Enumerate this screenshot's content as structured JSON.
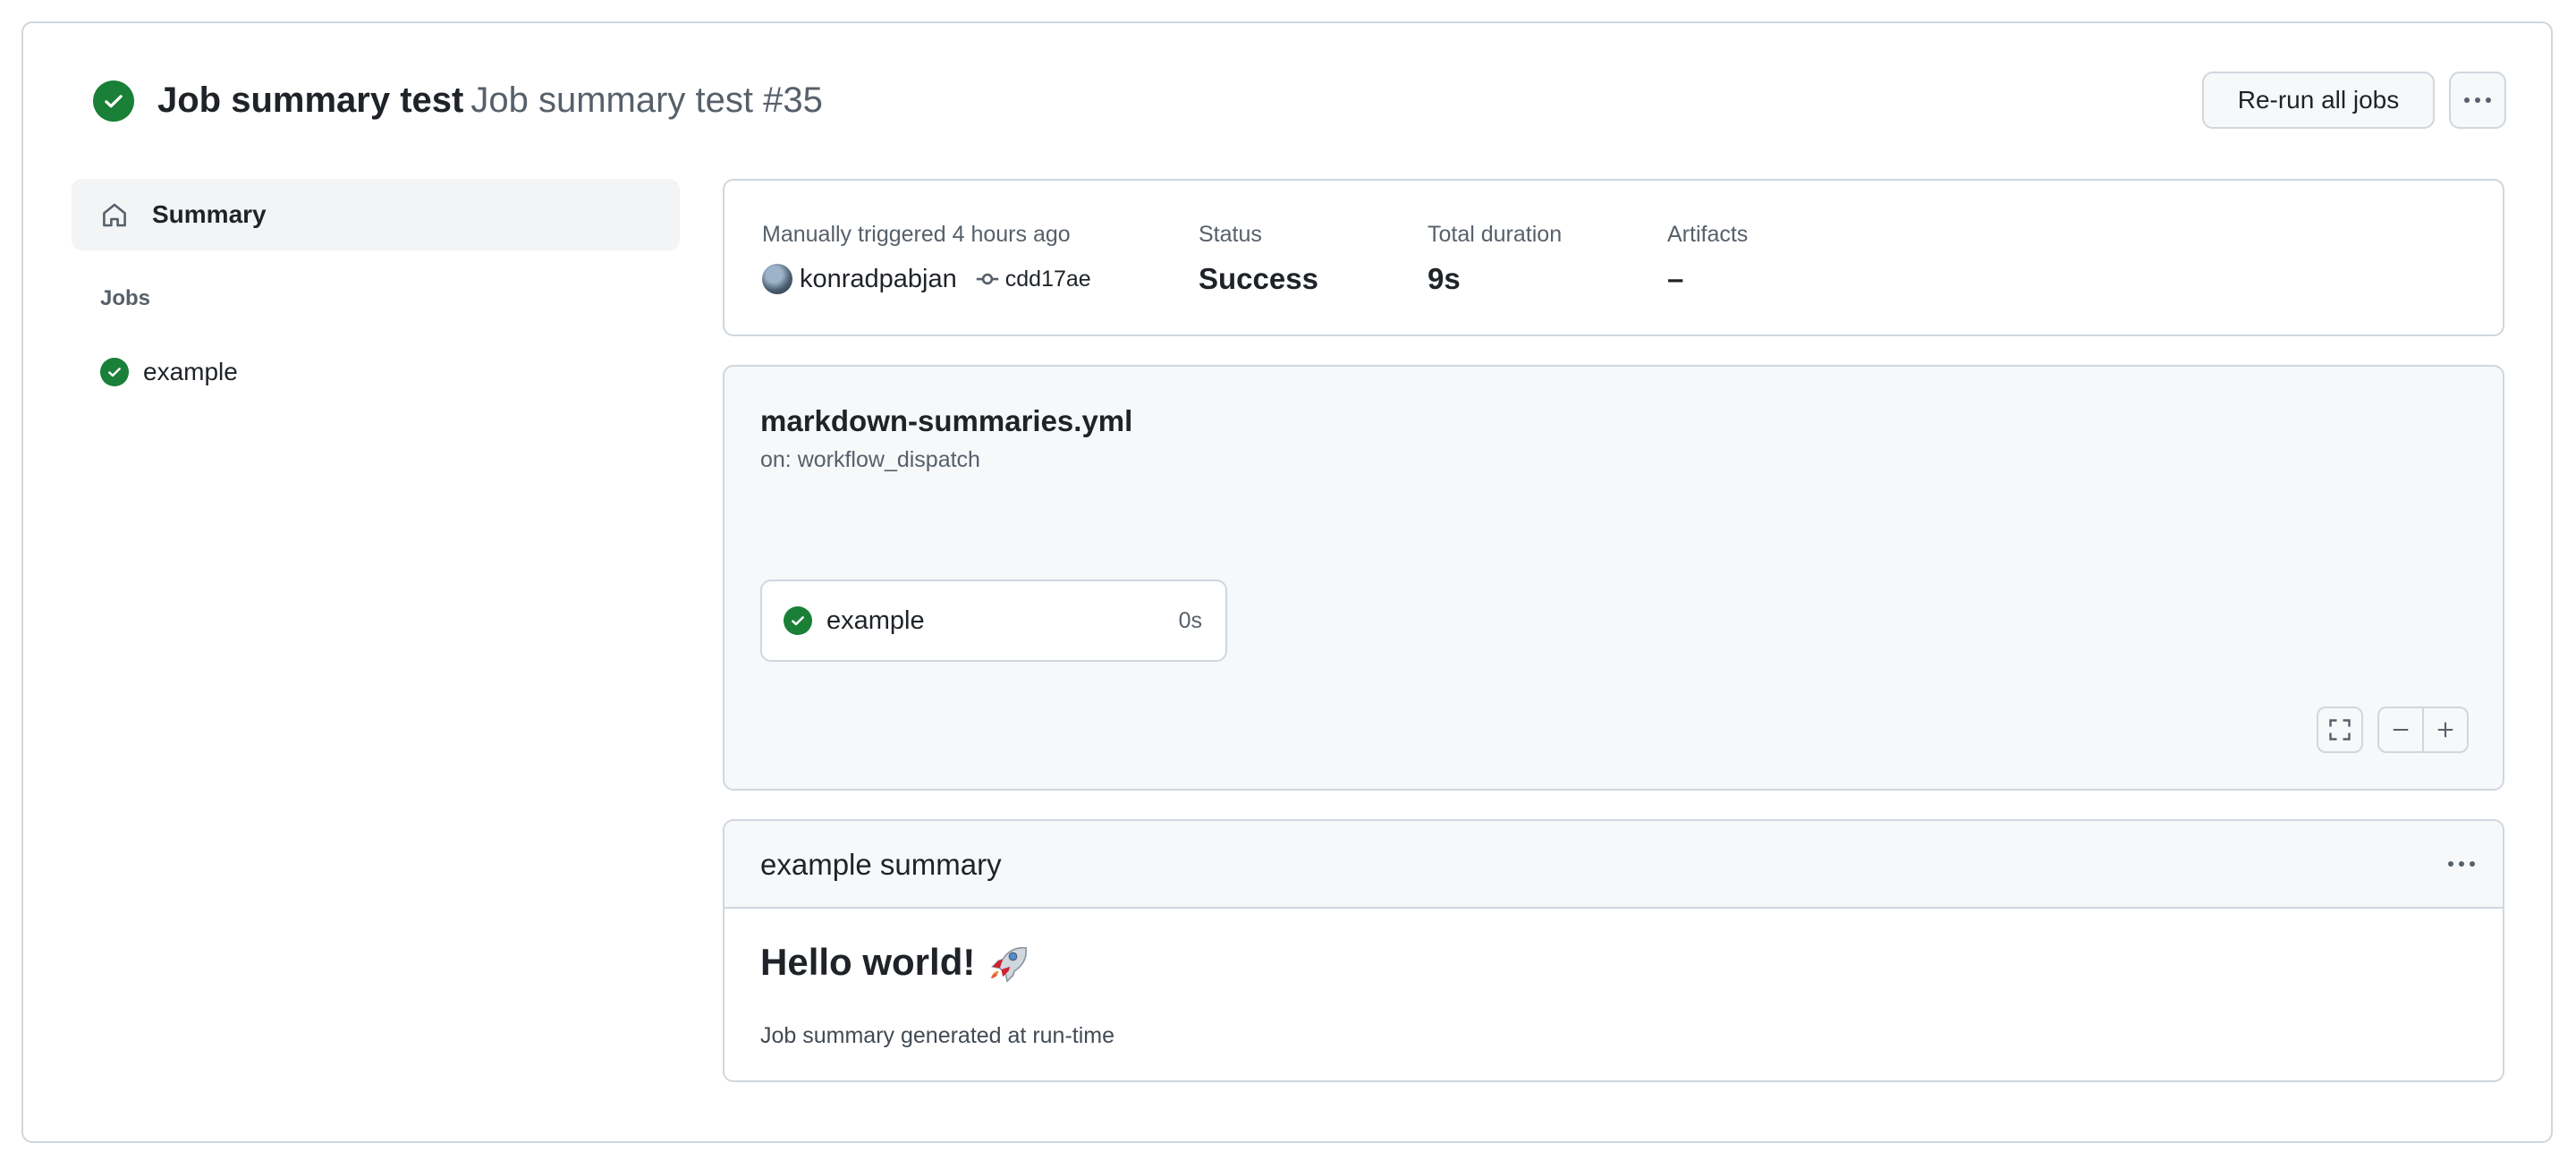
{
  "header": {
    "workflow_name": "Job summary test",
    "run_title": "Job summary test #35",
    "rerun_label": "Re-run all jobs",
    "more_icon": "kebab-horizontal-icon",
    "status_icon": "check-circle-icon"
  },
  "sidebar": {
    "summary_label": "Summary",
    "summary_icon": "home-icon",
    "jobs_heading": "Jobs",
    "jobs": [
      {
        "label": "example",
        "status": "success"
      }
    ]
  },
  "run_meta": {
    "trigger_label": "Manually triggered 4 hours ago",
    "actor": "konradpabjan",
    "commit_sha": "cdd17ae",
    "status_label": "Status",
    "status_value": "Success",
    "duration_label": "Total duration",
    "duration_value": "9s",
    "artifacts_label": "Artifacts",
    "artifacts_value": "–"
  },
  "workflow_graph": {
    "file": "markdown-summaries.yml",
    "trigger": "on: workflow_dispatch",
    "job": {
      "label": "example",
      "duration": "0s"
    },
    "controls": [
      "fullscreen-icon",
      "zoom-out-icon",
      "zoom-in-icon"
    ]
  },
  "job_summary": {
    "title": "example summary",
    "heading": "Hello world!",
    "heading_emoji": "rocket",
    "body": "Job summary generated at run-time"
  },
  "colors": {
    "success": "#1a7f37",
    "border": "#d0d7de",
    "muted": "#57606a",
    "canvas_subtle": "#f6f8fa"
  }
}
